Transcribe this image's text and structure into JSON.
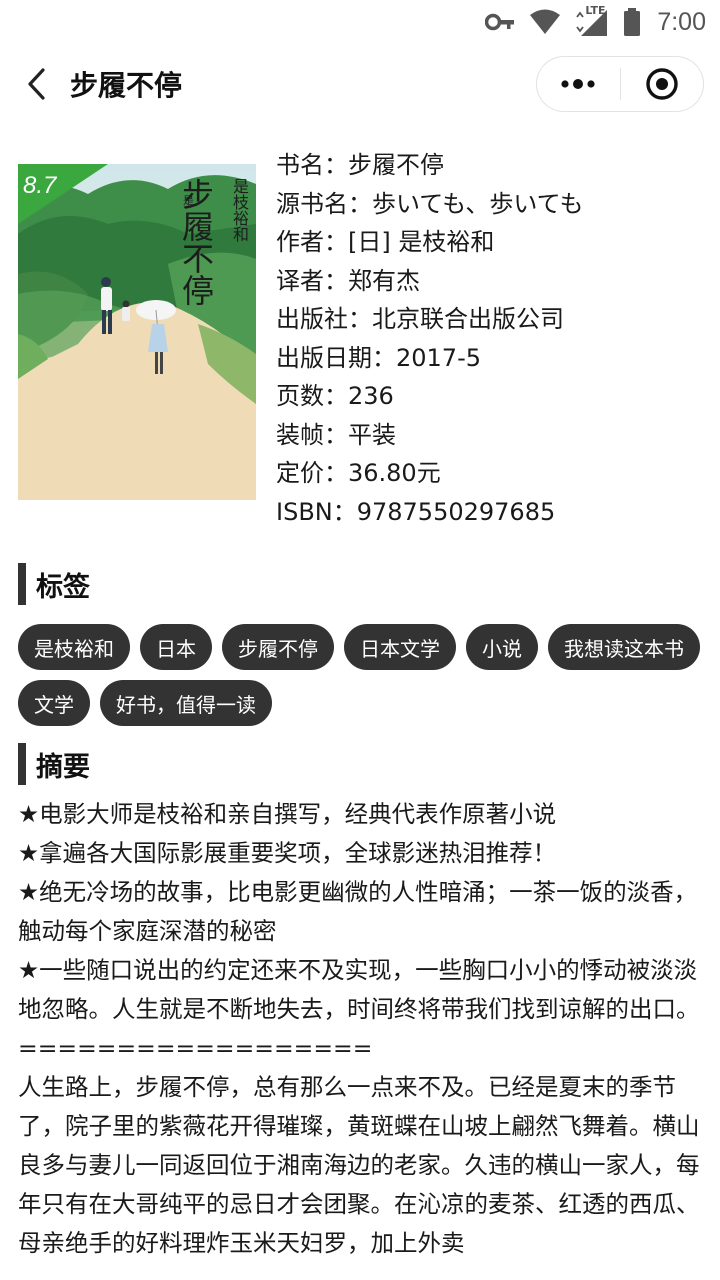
{
  "status_bar": {
    "time": "7:00",
    "network": "LTE",
    "icons": [
      "vpn-key-icon",
      "wifi-icon",
      "signal-icon",
      "battery-icon"
    ]
  },
  "nav": {
    "title": "步履不停",
    "icons": {
      "back": "back-arrow-icon",
      "more": "more-dots-icon",
      "close": "record-circle-icon"
    }
  },
  "book": {
    "rating": "8.7",
    "cover_title": "步履不停",
    "cover_author": "是枝裕和",
    "info": [
      "书名：步履不停",
      "源书名：歩いても、歩いても",
      "作者：[日] 是枝裕和",
      "译者：郑有杰",
      "出版社：北京联合出版公司",
      "出版日期：2017-5",
      "页数：236",
      "装帧：平装",
      "定价：36.80元",
      "ISBN：9787550297685"
    ]
  },
  "sections": {
    "tags_title": "标签",
    "summary_title": "摘要"
  },
  "tags": [
    "是枝裕和",
    "日本",
    "步履不停",
    "日本文学",
    "小说",
    "我想读这本书",
    "文学",
    "好书，值得一读"
  ],
  "summary": [
    "★电影大师是枝裕和亲自撰写，经典代表作原著小说",
    "★拿遍各大国际影展重要奖项，全球影迷热泪推荐！",
    "★绝无冷场的故事，比电影更幽微的人性暗涌；一茶一饭的淡香，触动每个家庭深潜的秘密",
    "★一些随口说出的约定还来不及实现，一些胸口小小的悸动被淡淡地忽略。人生就是不断地失去，时间终将带我们找到谅解的出口。",
    "==================",
    "人生路上，步履不停，总有那么一点来不及。已经是夏末的季节了，院子里的紫薇花开得璀璨，黄斑蝶在山坡上翩然飞舞着。横山良多与妻儿一同返回位于湘南海边的老家。久违的横山一家人，每年只有在大哥纯平的忌日才会团聚。在沁凉的麦茶、红透的西瓜、母亲绝手的好料理炸玉米天妇罗，加上外卖"
  ],
  "colors": {
    "tag_bg": "#333333",
    "tag_text": "#ffffff",
    "rating_badge": "#3aa83e",
    "section_bar": "#333333"
  }
}
